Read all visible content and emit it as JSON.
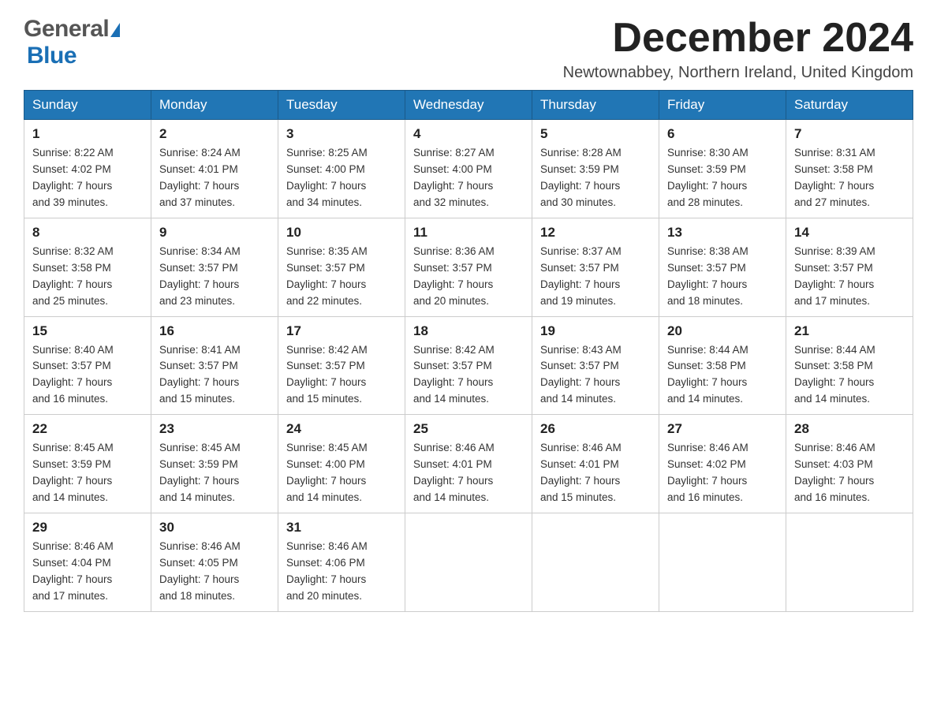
{
  "header": {
    "logo_general": "General",
    "logo_blue": "Blue",
    "month_title": "December 2024",
    "location": "Newtownabbey, Northern Ireland, United Kingdom"
  },
  "weekdays": [
    "Sunday",
    "Monday",
    "Tuesday",
    "Wednesday",
    "Thursday",
    "Friday",
    "Saturday"
  ],
  "weeks": [
    [
      {
        "day": "1",
        "sunrise": "Sunrise: 8:22 AM",
        "sunset": "Sunset: 4:02 PM",
        "daylight": "Daylight: 7 hours",
        "daylight2": "and 39 minutes."
      },
      {
        "day": "2",
        "sunrise": "Sunrise: 8:24 AM",
        "sunset": "Sunset: 4:01 PM",
        "daylight": "Daylight: 7 hours",
        "daylight2": "and 37 minutes."
      },
      {
        "day": "3",
        "sunrise": "Sunrise: 8:25 AM",
        "sunset": "Sunset: 4:00 PM",
        "daylight": "Daylight: 7 hours",
        "daylight2": "and 34 minutes."
      },
      {
        "day": "4",
        "sunrise": "Sunrise: 8:27 AM",
        "sunset": "Sunset: 4:00 PM",
        "daylight": "Daylight: 7 hours",
        "daylight2": "and 32 minutes."
      },
      {
        "day": "5",
        "sunrise": "Sunrise: 8:28 AM",
        "sunset": "Sunset: 3:59 PM",
        "daylight": "Daylight: 7 hours",
        "daylight2": "and 30 minutes."
      },
      {
        "day": "6",
        "sunrise": "Sunrise: 8:30 AM",
        "sunset": "Sunset: 3:59 PM",
        "daylight": "Daylight: 7 hours",
        "daylight2": "and 28 minutes."
      },
      {
        "day": "7",
        "sunrise": "Sunrise: 8:31 AM",
        "sunset": "Sunset: 3:58 PM",
        "daylight": "Daylight: 7 hours",
        "daylight2": "and 27 minutes."
      }
    ],
    [
      {
        "day": "8",
        "sunrise": "Sunrise: 8:32 AM",
        "sunset": "Sunset: 3:58 PM",
        "daylight": "Daylight: 7 hours",
        "daylight2": "and 25 minutes."
      },
      {
        "day": "9",
        "sunrise": "Sunrise: 8:34 AM",
        "sunset": "Sunset: 3:57 PM",
        "daylight": "Daylight: 7 hours",
        "daylight2": "and 23 minutes."
      },
      {
        "day": "10",
        "sunrise": "Sunrise: 8:35 AM",
        "sunset": "Sunset: 3:57 PM",
        "daylight": "Daylight: 7 hours",
        "daylight2": "and 22 minutes."
      },
      {
        "day": "11",
        "sunrise": "Sunrise: 8:36 AM",
        "sunset": "Sunset: 3:57 PM",
        "daylight": "Daylight: 7 hours",
        "daylight2": "and 20 minutes."
      },
      {
        "day": "12",
        "sunrise": "Sunrise: 8:37 AM",
        "sunset": "Sunset: 3:57 PM",
        "daylight": "Daylight: 7 hours",
        "daylight2": "and 19 minutes."
      },
      {
        "day": "13",
        "sunrise": "Sunrise: 8:38 AM",
        "sunset": "Sunset: 3:57 PM",
        "daylight": "Daylight: 7 hours",
        "daylight2": "and 18 minutes."
      },
      {
        "day": "14",
        "sunrise": "Sunrise: 8:39 AM",
        "sunset": "Sunset: 3:57 PM",
        "daylight": "Daylight: 7 hours",
        "daylight2": "and 17 minutes."
      }
    ],
    [
      {
        "day": "15",
        "sunrise": "Sunrise: 8:40 AM",
        "sunset": "Sunset: 3:57 PM",
        "daylight": "Daylight: 7 hours",
        "daylight2": "and 16 minutes."
      },
      {
        "day": "16",
        "sunrise": "Sunrise: 8:41 AM",
        "sunset": "Sunset: 3:57 PM",
        "daylight": "Daylight: 7 hours",
        "daylight2": "and 15 minutes."
      },
      {
        "day": "17",
        "sunrise": "Sunrise: 8:42 AM",
        "sunset": "Sunset: 3:57 PM",
        "daylight": "Daylight: 7 hours",
        "daylight2": "and 15 minutes."
      },
      {
        "day": "18",
        "sunrise": "Sunrise: 8:42 AM",
        "sunset": "Sunset: 3:57 PM",
        "daylight": "Daylight: 7 hours",
        "daylight2": "and 14 minutes."
      },
      {
        "day": "19",
        "sunrise": "Sunrise: 8:43 AM",
        "sunset": "Sunset: 3:57 PM",
        "daylight": "Daylight: 7 hours",
        "daylight2": "and 14 minutes."
      },
      {
        "day": "20",
        "sunrise": "Sunrise: 8:44 AM",
        "sunset": "Sunset: 3:58 PM",
        "daylight": "Daylight: 7 hours",
        "daylight2": "and 14 minutes."
      },
      {
        "day": "21",
        "sunrise": "Sunrise: 8:44 AM",
        "sunset": "Sunset: 3:58 PM",
        "daylight": "Daylight: 7 hours",
        "daylight2": "and 14 minutes."
      }
    ],
    [
      {
        "day": "22",
        "sunrise": "Sunrise: 8:45 AM",
        "sunset": "Sunset: 3:59 PM",
        "daylight": "Daylight: 7 hours",
        "daylight2": "and 14 minutes."
      },
      {
        "day": "23",
        "sunrise": "Sunrise: 8:45 AM",
        "sunset": "Sunset: 3:59 PM",
        "daylight": "Daylight: 7 hours",
        "daylight2": "and 14 minutes."
      },
      {
        "day": "24",
        "sunrise": "Sunrise: 8:45 AM",
        "sunset": "Sunset: 4:00 PM",
        "daylight": "Daylight: 7 hours",
        "daylight2": "and 14 minutes."
      },
      {
        "day": "25",
        "sunrise": "Sunrise: 8:46 AM",
        "sunset": "Sunset: 4:01 PM",
        "daylight": "Daylight: 7 hours",
        "daylight2": "and 14 minutes."
      },
      {
        "day": "26",
        "sunrise": "Sunrise: 8:46 AM",
        "sunset": "Sunset: 4:01 PM",
        "daylight": "Daylight: 7 hours",
        "daylight2": "and 15 minutes."
      },
      {
        "day": "27",
        "sunrise": "Sunrise: 8:46 AM",
        "sunset": "Sunset: 4:02 PM",
        "daylight": "Daylight: 7 hours",
        "daylight2": "and 16 minutes."
      },
      {
        "day": "28",
        "sunrise": "Sunrise: 8:46 AM",
        "sunset": "Sunset: 4:03 PM",
        "daylight": "Daylight: 7 hours",
        "daylight2": "and 16 minutes."
      }
    ],
    [
      {
        "day": "29",
        "sunrise": "Sunrise: 8:46 AM",
        "sunset": "Sunset: 4:04 PM",
        "daylight": "Daylight: 7 hours",
        "daylight2": "and 17 minutes."
      },
      {
        "day": "30",
        "sunrise": "Sunrise: 8:46 AM",
        "sunset": "Sunset: 4:05 PM",
        "daylight": "Daylight: 7 hours",
        "daylight2": "and 18 minutes."
      },
      {
        "day": "31",
        "sunrise": "Sunrise: 8:46 AM",
        "sunset": "Sunset: 4:06 PM",
        "daylight": "Daylight: 7 hours",
        "daylight2": "and 20 minutes."
      },
      null,
      null,
      null,
      null
    ]
  ]
}
